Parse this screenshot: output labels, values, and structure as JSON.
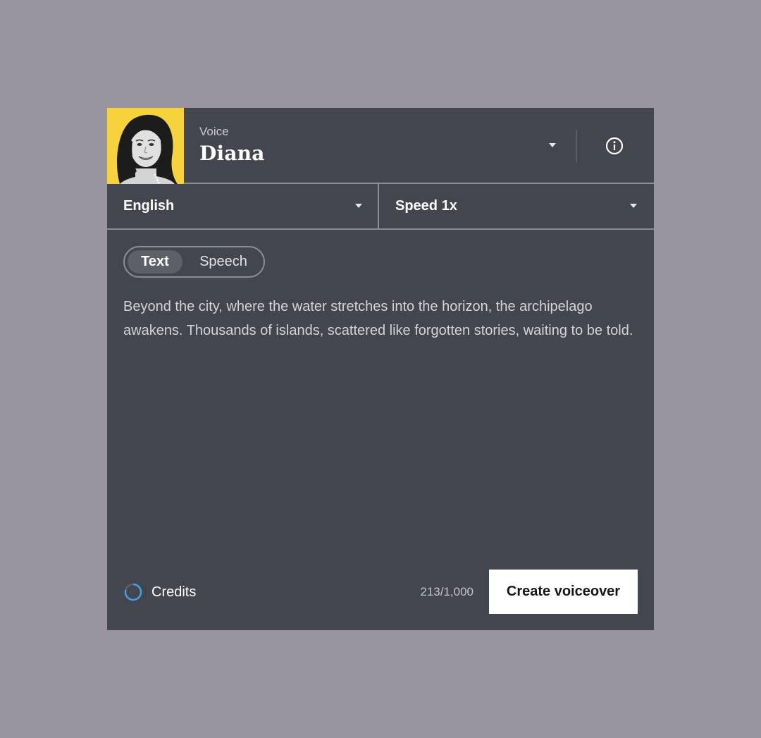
{
  "voice": {
    "label": "Voice",
    "name": "Diana"
  },
  "language": {
    "selected": "English"
  },
  "speed": {
    "selected": "Speed 1x"
  },
  "mode_toggle": {
    "options": [
      "Text",
      "Speech"
    ],
    "active": "Text"
  },
  "script_text": "Beyond the city, where the water stretches into the horizon, the archipelago awakens. Thousands of islands, scattered like forgotten stories, waiting to be told.",
  "footer": {
    "credits_label": "Credits",
    "character_count": "213/1,000",
    "create_button_label": "Create voiceover"
  },
  "colors": {
    "page_background": "#97949f",
    "panel_background": "#44464f",
    "avatar_background": "#f6d33c",
    "credits_ring_accent": "#3ea6e6",
    "button_background": "#ffffff"
  },
  "icons": {
    "voice_dropdown": "chevron-down-icon",
    "info": "info-icon",
    "language_dropdown": "chevron-down-icon",
    "speed_dropdown": "chevron-down-icon",
    "credits": "progress-ring-icon"
  }
}
